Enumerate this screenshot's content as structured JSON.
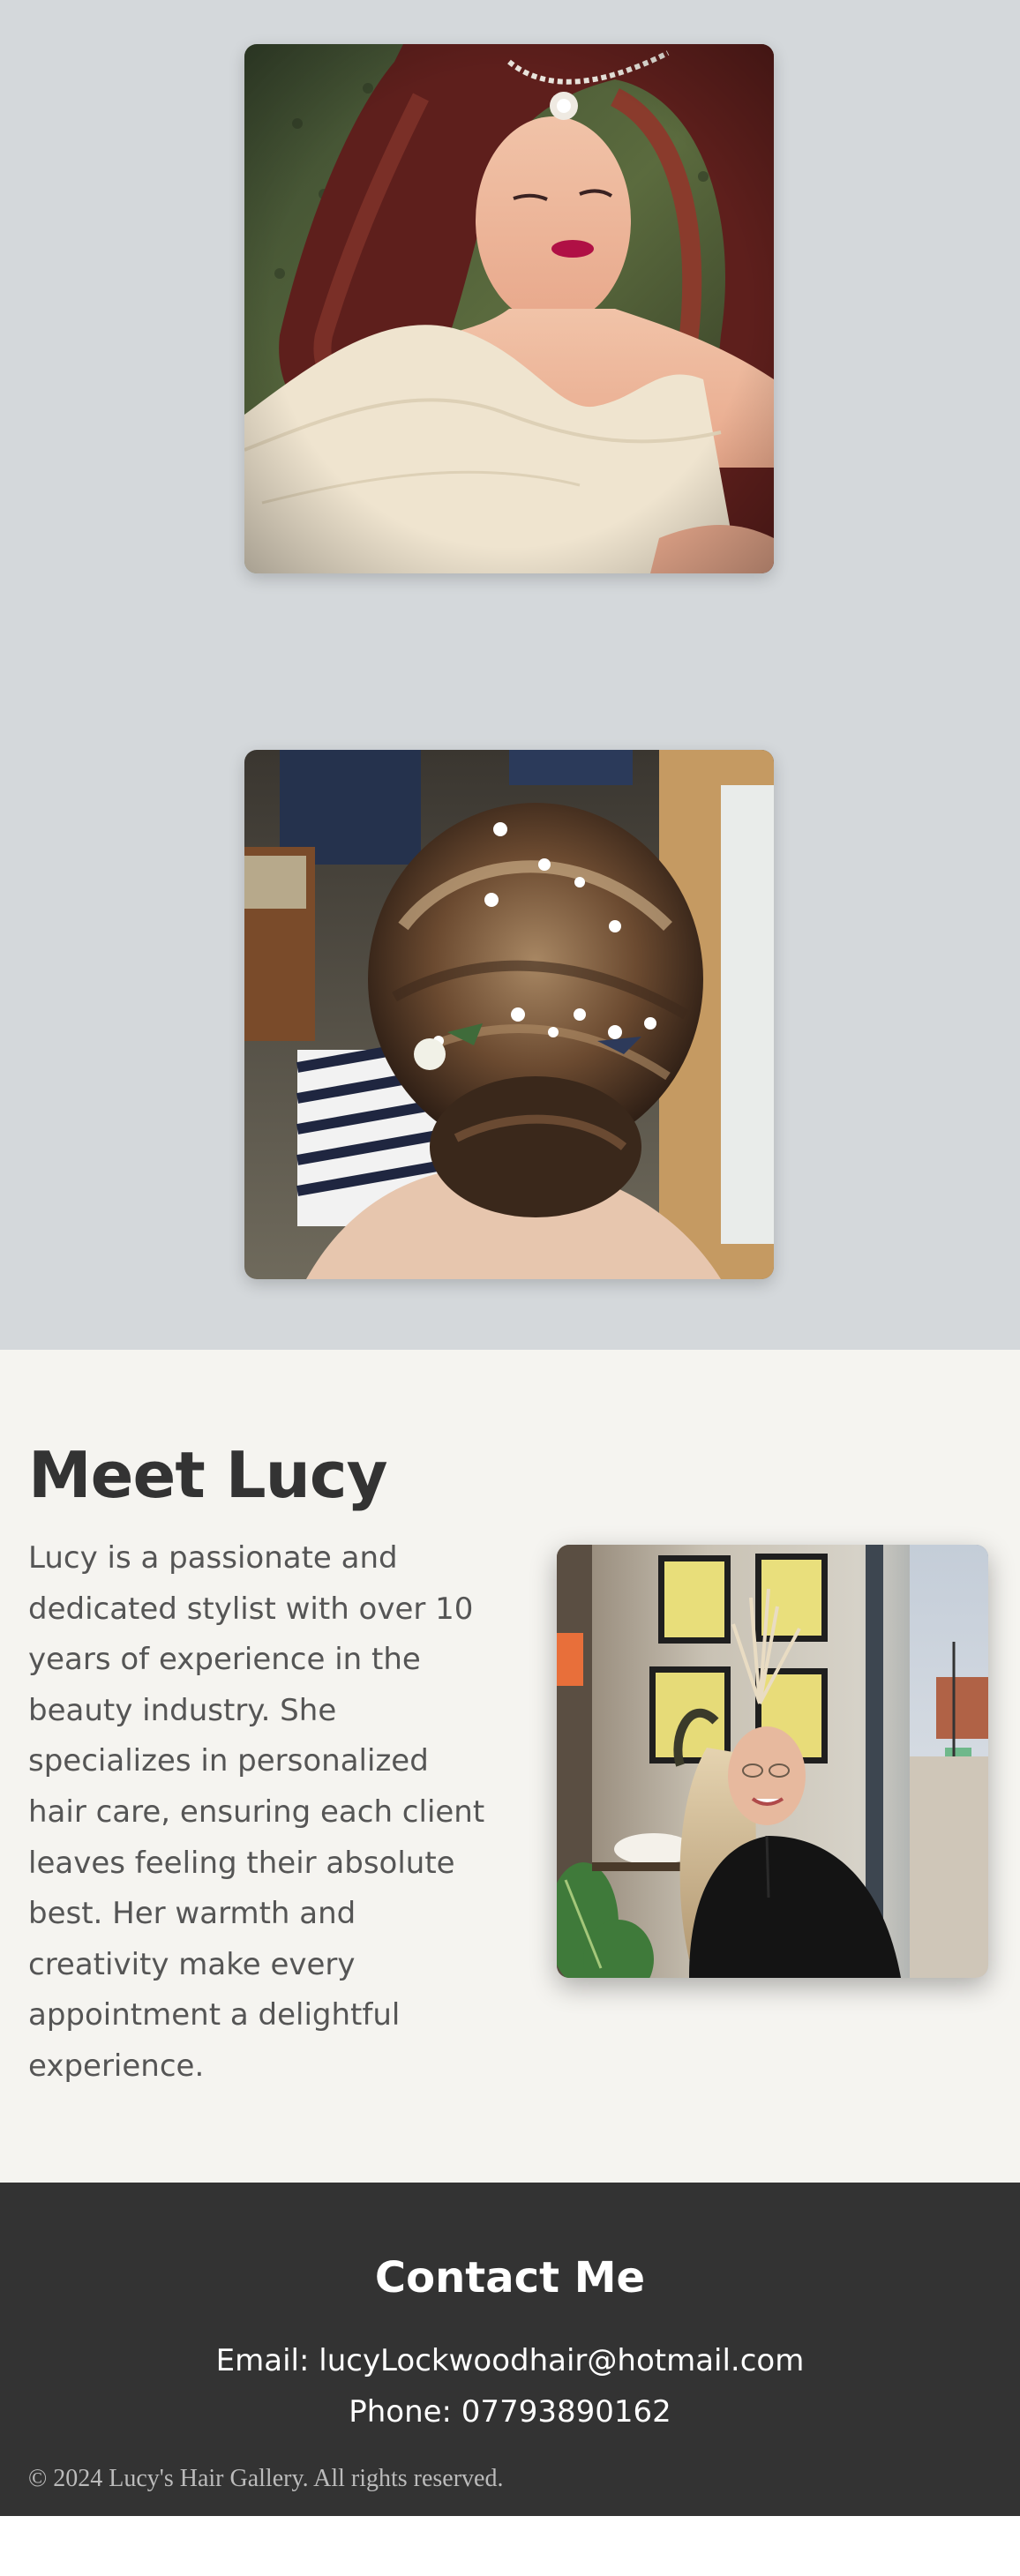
{
  "gallery": {
    "photos": [
      {
        "icon": "bridal-portrait-photo"
      },
      {
        "icon": "floral-updo-photo"
      }
    ]
  },
  "about": {
    "title": "Meet Lucy",
    "text": "Lucy is a passionate and dedicated stylist with over 10 years of experience in the beauty industry. She specializes in personalized hair care, ensuring each client leaves feeling their absolute best. Her warmth and creativity make every appointment a delightful experience.",
    "photo_icon": "stylist-portrait-photo"
  },
  "contact": {
    "title": "Contact Me",
    "email_line": "Email: lucyLockwoodhair@hotmail.com",
    "phone_line": "Phone: 07793890162",
    "copyright": "© 2024 Lucy's Hair Gallery. All rights reserved."
  },
  "colors": {
    "gallery_bg": "#d4d8db",
    "about_bg": "#f5f4f0",
    "footer_bg": "#333333",
    "heading": "#333333",
    "body_text": "#555555"
  }
}
